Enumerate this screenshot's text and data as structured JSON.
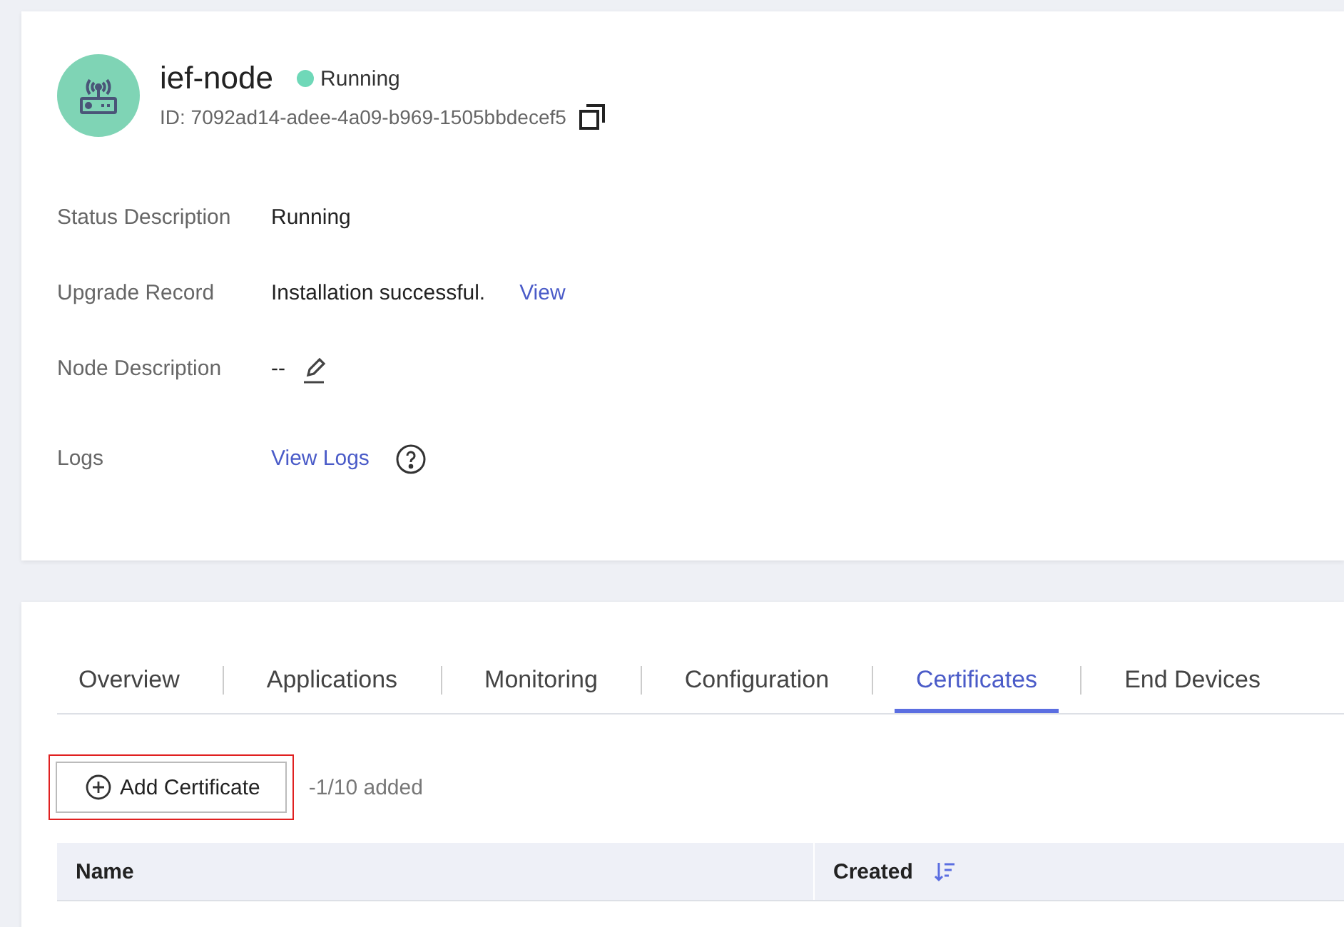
{
  "node": {
    "name": "ief-node",
    "status": "Running",
    "id": "ID: 7092ad14-adee-4a09-b969-1505bbdecef5"
  },
  "details": [
    {
      "kind": "text",
      "label": "Status Description",
      "value": "Running"
    },
    {
      "kind": "link",
      "label": "Upgrade Record",
      "value": "Installation successful.",
      "link": "View"
    },
    {
      "kind": "edit",
      "label": "Node Description",
      "value": "--"
    },
    {
      "kind": "help",
      "label": "Logs",
      "link": "View Logs"
    }
  ],
  "tabs": [
    {
      "label": "Overview",
      "selected": false
    },
    {
      "label": "Applications",
      "selected": false
    },
    {
      "label": "Monitoring",
      "selected": false
    },
    {
      "label": "Configuration",
      "selected": false
    },
    {
      "label": "Certificates",
      "selected": true
    },
    {
      "label": "End Devices",
      "selected": false
    }
  ],
  "add_button": {
    "label": "Add Certificate",
    "highlighted": true
  },
  "count": "-1/10 added",
  "table": {
    "columns": [
      {
        "label": "Name",
        "sortable": false
      },
      {
        "label": "Created",
        "sortable": true
      }
    ]
  }
}
